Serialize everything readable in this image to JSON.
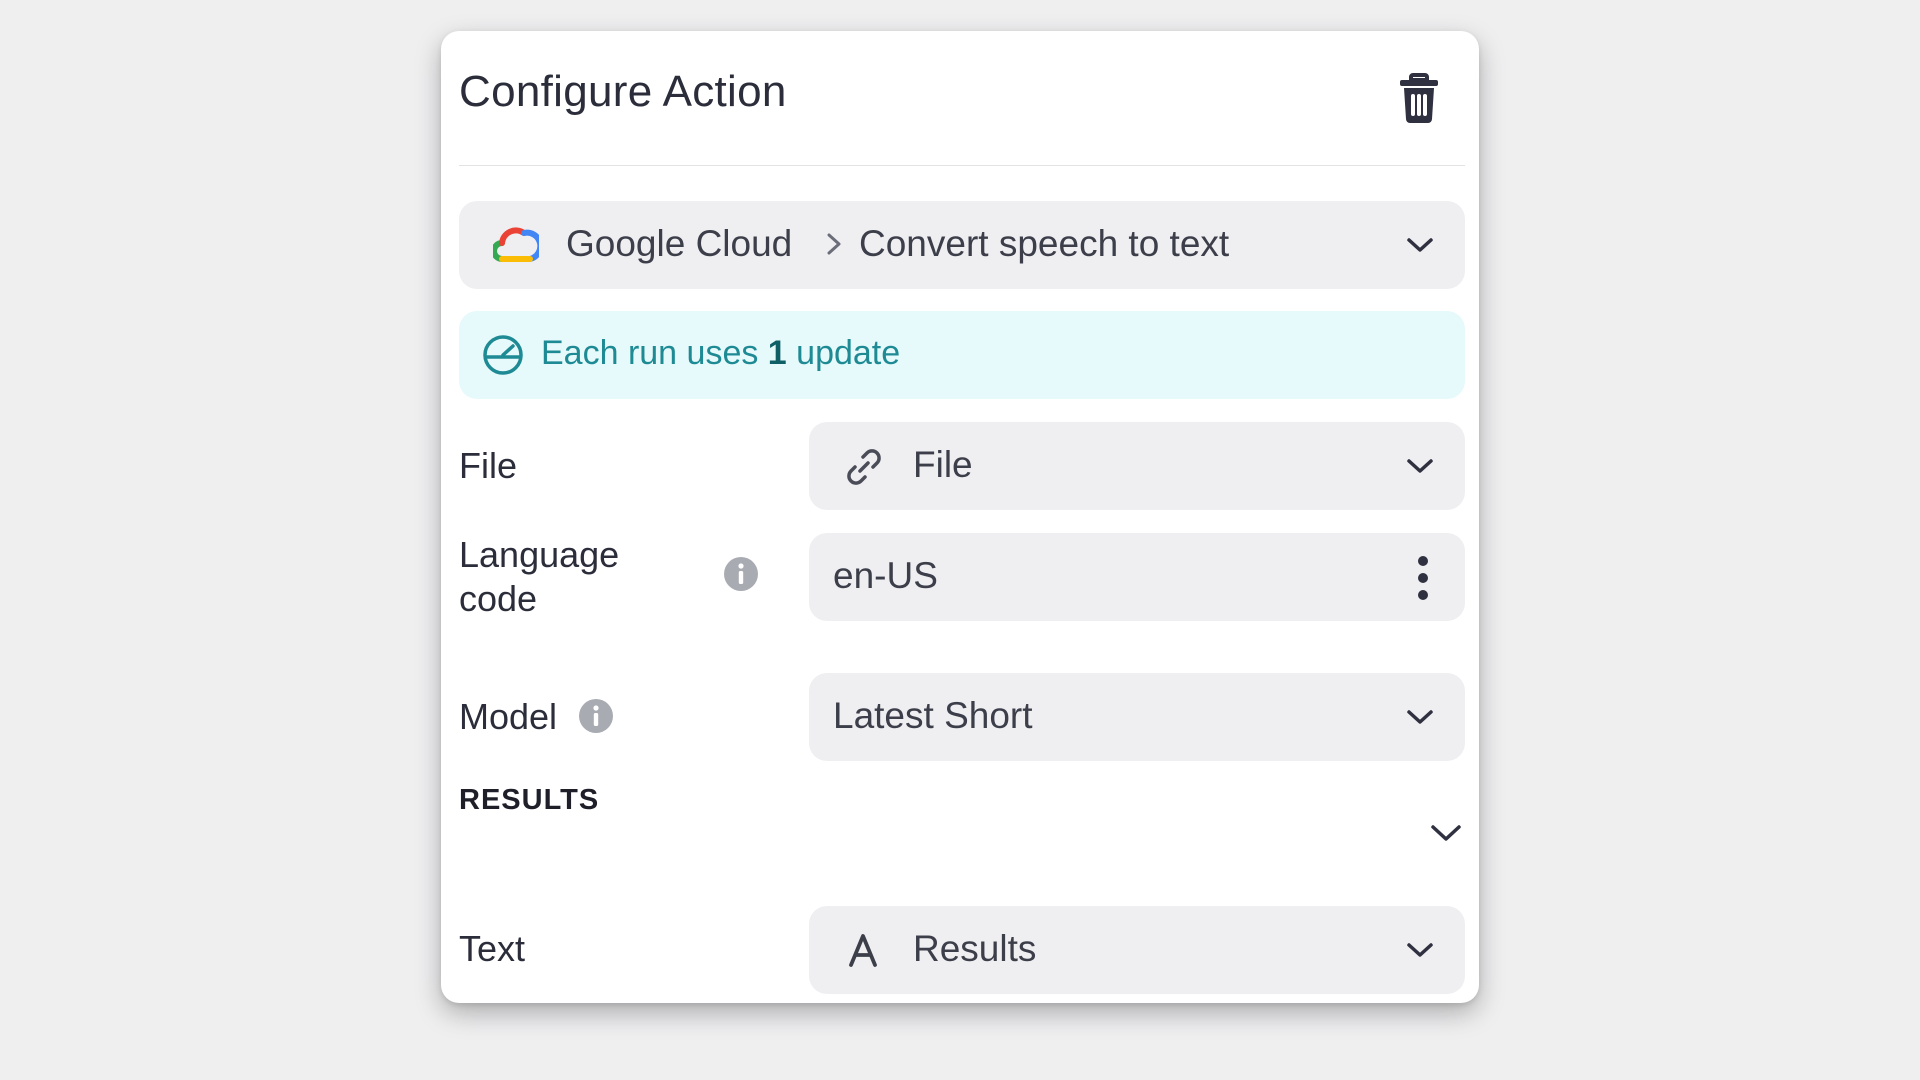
{
  "panel": {
    "title": "Configure Action"
  },
  "app_selector": {
    "app": "Google Cloud",
    "separator": ">",
    "action": "Convert speech to text"
  },
  "usage_banner": {
    "prefix": "Each run uses ",
    "count": "1",
    "suffix": " update"
  },
  "fields": {
    "file": {
      "label": "File",
      "value": "File",
      "icon": "link-icon"
    },
    "language_code": {
      "label_line1": "Language",
      "label_line2": "code",
      "value": "en-US"
    },
    "model": {
      "label": "Model",
      "value": "Latest Short"
    }
  },
  "results": {
    "section_title": "RESULTS",
    "text": {
      "label": "Text",
      "value": "Results",
      "icon": "text-type-icon"
    }
  },
  "colors": {
    "background": "#efeff0",
    "panel": "#ffffff",
    "field": "#efeff2",
    "banner_bg": "#e6f9fb",
    "banner_text": "#1d8a94"
  }
}
